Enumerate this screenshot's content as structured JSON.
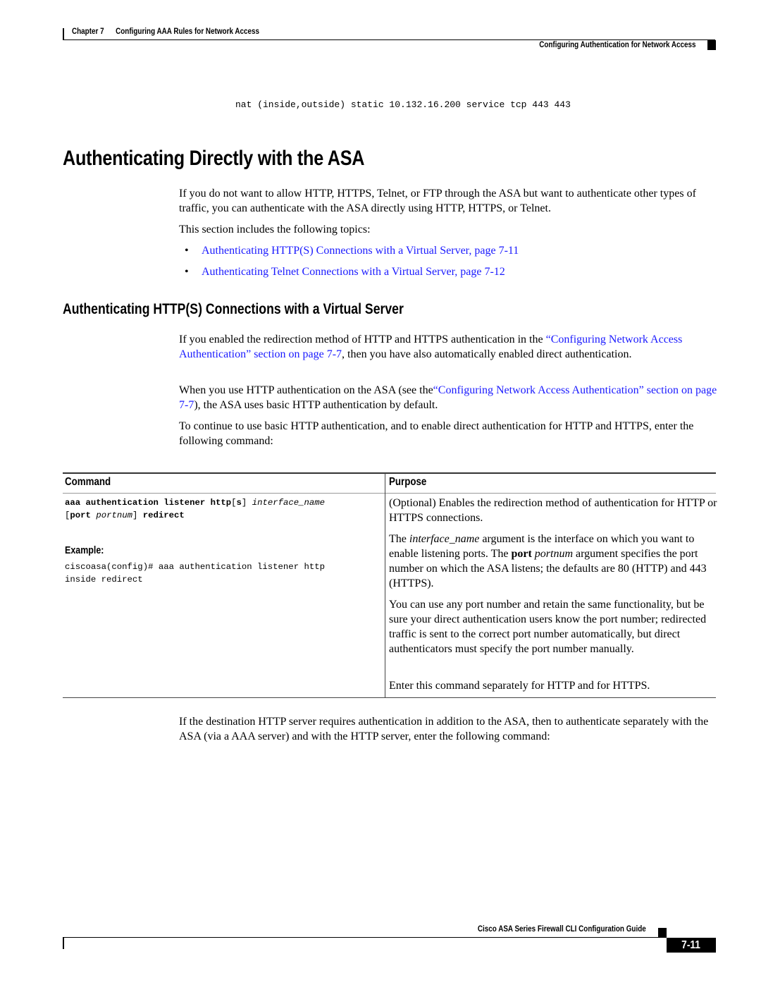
{
  "header": {
    "chapter": "Chapter 7      Configuring AAA Rules for Network Access",
    "section": "Configuring Authentication for Network Access"
  },
  "code_top": "nat (inside,outside) static 10.132.16.200 service tcp 443 443",
  "section1": {
    "title": "Authenticating Directly with the ASA",
    "para1": "If you do not want to allow HTTP, HTTPS, Telnet, or FTP through the ASA but want to authenticate other types of traffic, you can authenticate with the ASA directly using HTTP, HTTPS, or Telnet.",
    "para2": "This section includes the following topics:",
    "topics": [
      {
        "label": "Authenticating HTTP(S) Connections with a Virtual Server, page 7-11"
      },
      {
        "label": "Authenticating Telnet Connections with a Virtual Server, page 7-12"
      }
    ]
  },
  "section2": {
    "title": "Authenticating HTTP(S) Connections with a Virtual Server",
    "para1_pre": "If you enabled the redirection method of HTTP and HTTPS authentication in the ",
    "para1_link": "“Configuring Network Access Authentication” section on page 7-7",
    "para1_post": ", then you have also automatically enabled direct authentication.",
    "para2_pre": "When you use HTTP authentication on the ASA (see the",
    "para2_link": "“Configuring Network Access Authentication” section on page 7-7",
    "para2_post": "), the ASA uses basic HTTP authentication by default.",
    "para3": "To continue to use basic HTTP authentication, and to enable direct authentication for HTTP and HTTPS, enter the following command:"
  },
  "table": {
    "headers": {
      "command": "Command",
      "purpose": "Purpose"
    },
    "command": {
      "kw1": "aaa authentication listener http",
      "br_open": "[",
      "opt_s": "s",
      "br_close": "]",
      "arg1": "interface_name",
      "kw_port": "port",
      "arg_portnum": "portnum",
      "kw_redirect": "redirect"
    },
    "example_label": "Example:",
    "example_lines": [
      "ciscoasa(config)# aaa authentication listener http",
      "inside redirect"
    ],
    "purpose": {
      "p1": "(Optional) Enables the redirection method of authentication for HTTP or HTTPS connections.",
      "p2_a": "The ",
      "p2_arg": "interface_name",
      "p2_b": " argument is the interface on which you want to enable listening ports. The ",
      "p2_port": "port",
      "p2_portnum": "portnum",
      "p2_c": " argument specifies the port number on which the ASA listens; the defaults are 80 (HTTP) and 443 (HTTPS).",
      "p3": "You can use any port number and retain the same functionality, but be sure your direct authentication users know the port number; redirected traffic is sent to the correct port number automatically, but direct authenticators must specify the port number manually.",
      "p4": "Enter this command separately for HTTP and for HTTPS."
    }
  },
  "after_table": "If the destination HTTP server requires authentication in addition to the ASA, then to authenticate separately with the ASA (via a AAA server) and with the HTTP server, enter the following command:",
  "footer": {
    "guide_title": "Cisco ASA Series Firewall CLI Configuration Guide",
    "page_number": "7-11"
  },
  "colors": {
    "link": "#1a1aff",
    "text": "#000000"
  }
}
